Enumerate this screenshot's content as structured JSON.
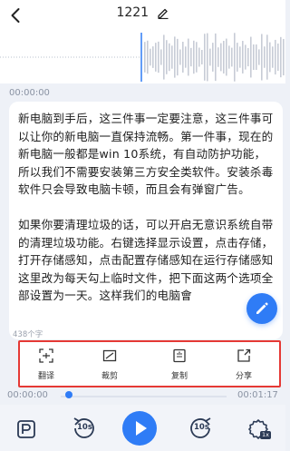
{
  "header": {
    "title": "1221",
    "back_icon": "chevron-left-icon",
    "edit_icon": "pencil-icon"
  },
  "player": {
    "time_start": "00:00:00",
    "time_current": "00:00:00",
    "time_total": "00:01:17",
    "progress_fraction": 0.0,
    "skip_back_label": "10s",
    "skip_forward_label": "10s",
    "accent": "#2f7cf6"
  },
  "transcript": {
    "paragraph1": "新电脑到手后，这三件事一定要注意，这三件事可以让你的新电脑一直保持流畅。第一件事，现在的新电脑一般都是win 10系统，有自动防护功能，所以我们不需要安装第三方安全类软件。安装杀毒软件只会导致电脑卡顿，而且会有弹窗广告。",
    "paragraph2": "如果你要清理垃圾的话，可以开启无意识系统自带的清理垃圾功能。右键选择显示设置，点击存储，打开存储感知，点击配置存储感知在运行存储感知这里改为每天勾上临时文件，把下面这两个选项全部设置为一天。这样我们的电脑會",
    "char_count": "438个字"
  },
  "actions": [
    {
      "label": "翻译",
      "icon": "translate-icon"
    },
    {
      "label": "裁剪",
      "icon": "crop-icon"
    },
    {
      "label": "复制",
      "icon": "copy-icon"
    },
    {
      "label": "分享",
      "icon": "share-icon"
    }
  ],
  "toolbar": {
    "left_icon": "text-mode-icon",
    "right_icon": "speed-settings-icon",
    "right_badge": "1x"
  },
  "colors": {
    "highlight_border": "#e53935",
    "fab": "#2f7cf6"
  }
}
